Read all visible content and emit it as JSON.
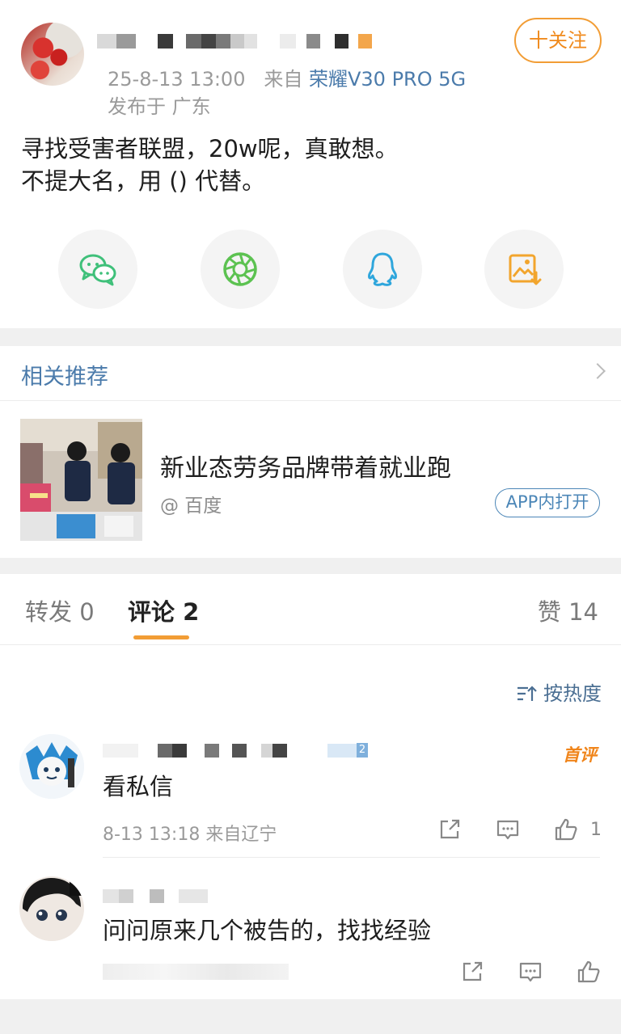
{
  "post": {
    "time": "25-8-13 13:00",
    "from_label": "来自",
    "device": "荣耀V30 PRO 5G",
    "location": "发布于 广东",
    "follow_label": "十关注",
    "text_line1": "寻找受害者联盟，20w呢，真敢想。",
    "text_line2": "不提大名，用 () 代替。",
    "share_icons": [
      "wechat-icon",
      "moments-icon",
      "qq-icon",
      "save-image-icon"
    ],
    "colors": {
      "accent": "#f29d35",
      "link": "#4b7bab",
      "wechat": "#3fc07a",
      "moments": "#5cc251",
      "qq": "#2fa6dc",
      "save": "#f2a52d"
    }
  },
  "related": {
    "title": "相关推荐",
    "item_title": "新业态劳务品牌带着就业跑",
    "item_source": "@ 百度",
    "open_label": "APP内打开"
  },
  "tabs": {
    "repost": "转发 0",
    "comments": "评论 2",
    "likes": "赞 14"
  },
  "sort_label": "按热度",
  "comments": [
    {
      "text": "看私信",
      "meta": "8-13 13:18 来自辽宁",
      "like_count": "1",
      "badge": "首评",
      "level_badge": "2"
    },
    {
      "text": "问问原来几个被告的，找找经验",
      "meta": "",
      "like_count": ""
    }
  ]
}
